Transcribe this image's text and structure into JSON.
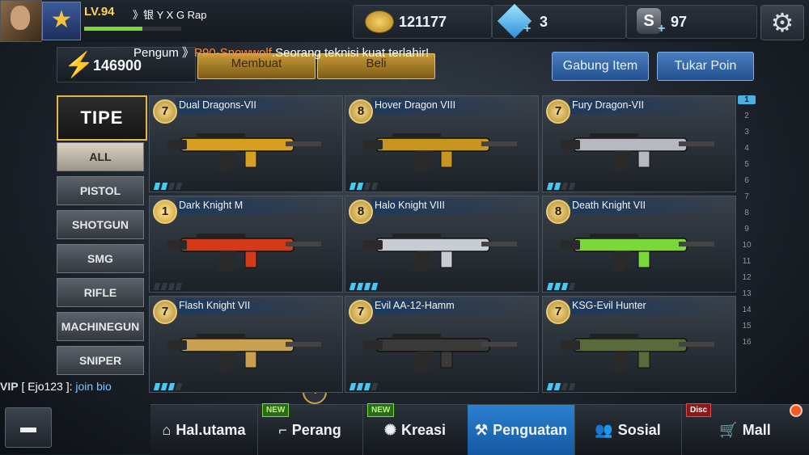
{
  "player": {
    "level": "LV.94",
    "name": "》银 Y X G Rap",
    "xp_fraction": 0.6
  },
  "resources": {
    "gold": "121177",
    "gems": "3",
    "s_points": "97"
  },
  "energy": {
    "value": "146900"
  },
  "tabs": {
    "membuat": "Membuat",
    "beli": "Beli"
  },
  "ticker": {
    "prefix": "Pengum 》",
    "highlight": "P90-Snowwolf",
    "suffix": ".Seorang teknisi kuat terlahir!"
  },
  "buttons": {
    "gabung": "Gabung Item",
    "tukar": "Tukar Poin"
  },
  "category_header": "TIPE",
  "categories": [
    "ALL",
    "PISTOL",
    "SHOTGUN",
    "SMG",
    "RIFLE",
    "MACHINEGUN",
    "SNIPER"
  ],
  "weapons": [
    {
      "name": "Dual Dragons-VII",
      "level": "7",
      "stars": 2,
      "color": "#d8a020"
    },
    {
      "name": "Hover Dragon VIII",
      "level": "8",
      "stars": 2,
      "color": "#c8961e"
    },
    {
      "name": "Fury Dragon-VII",
      "level": "7",
      "stars": 2,
      "color": "#b8b8c0"
    },
    {
      "name": "Dark Knight M",
      "level": "1",
      "stars": 0,
      "color": "#d43a1a"
    },
    {
      "name": "Halo Knight VIII",
      "level": "8",
      "stars": 4,
      "color": "#c8ccd4"
    },
    {
      "name": "Death Knight VII",
      "level": "8",
      "stars": 3,
      "color": "#7ad83a"
    },
    {
      "name": "Flash Knight VII",
      "level": "7",
      "stars": 3,
      "color": "#c8a050"
    },
    {
      "name": "Evil AA-12-Hamm",
      "level": "7",
      "stars": 3,
      "color": "#3a3a3a"
    },
    {
      "name": "KSG-Evil Hunter",
      "level": "7",
      "stars": 2,
      "color": "#5a6a3a"
    }
  ],
  "pages": [
    "1",
    "2",
    "3",
    "4",
    "5",
    "6",
    "7",
    "8",
    "9",
    "10",
    "11",
    "12",
    "13",
    "14",
    "15",
    "16"
  ],
  "vip": {
    "label": "VIP",
    "user": "[ Ejo123 ]:",
    "message": "join bio"
  },
  "nav": [
    {
      "label": "Hal.utama",
      "icon": "home-icon",
      "badge": ""
    },
    {
      "label": "Perang",
      "icon": "gun-icon",
      "badge": "NEW"
    },
    {
      "label": "Kreasi",
      "icon": "bulb-icon",
      "badge": "NEW"
    },
    {
      "label": "Penguatan",
      "icon": "hammer-icon",
      "badge": ""
    },
    {
      "label": "Sosial",
      "icon": "people-icon",
      "badge": ""
    },
    {
      "label": "Mall",
      "icon": "cart-icon",
      "badge": "Disc"
    }
  ]
}
